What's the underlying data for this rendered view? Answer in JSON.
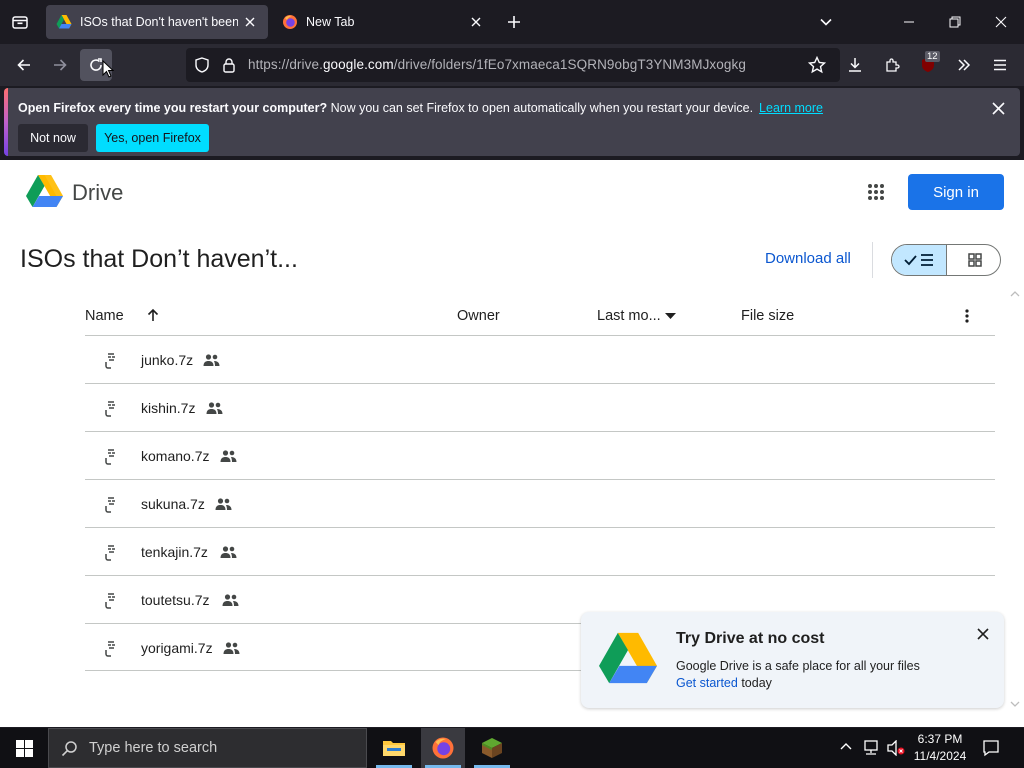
{
  "browser": {
    "tabs": [
      {
        "title": "ISOs that Don't haven't been up",
        "active": true
      },
      {
        "title": "New Tab",
        "active": false
      }
    ],
    "url": {
      "prefix": "https://drive.",
      "host": "google.com",
      "path": "/drive/folders/1fEo7xmaeca1SQRN9obgT3YNM3MJxogkg"
    },
    "extension_badge": "12"
  },
  "notification": {
    "bold": "Open Firefox every time you restart your computer?",
    "message": "Now you can set Firefox to open automatically when you restart your device.",
    "learn_more": "Learn more",
    "not_now": "Not now",
    "yes_open": "Yes, open Firefox"
  },
  "drive": {
    "logo_text": "Drive",
    "sign_in": "Sign in",
    "folder_title": "ISOs that Don’t haven’t...",
    "download_all": "Download all",
    "columns": {
      "name": "Name",
      "owner": "Owner",
      "last_modified": "Last mo...",
      "file_size": "File size"
    },
    "files": [
      {
        "name": "junko.7z"
      },
      {
        "name": "kishin.7z"
      },
      {
        "name": "komano.7z"
      },
      {
        "name": "sukuna.7z"
      },
      {
        "name": "tenkajin.7z"
      },
      {
        "name": "toutetsu.7z"
      },
      {
        "name": "yorigami.7z"
      }
    ],
    "promo": {
      "title": "Try Drive at no cost",
      "body": "Google Drive is a safe place for all your files",
      "link": "Get started",
      "suffix": "today"
    }
  },
  "taskbar": {
    "search_placeholder": "Type here to search",
    "time": "6:37 PM",
    "date": "11/4/2024"
  },
  "colors": {
    "accent_blue": "#1a73e8",
    "firefox_cyan": "#00ddff",
    "toggle_selected": "#c2e7ff"
  }
}
